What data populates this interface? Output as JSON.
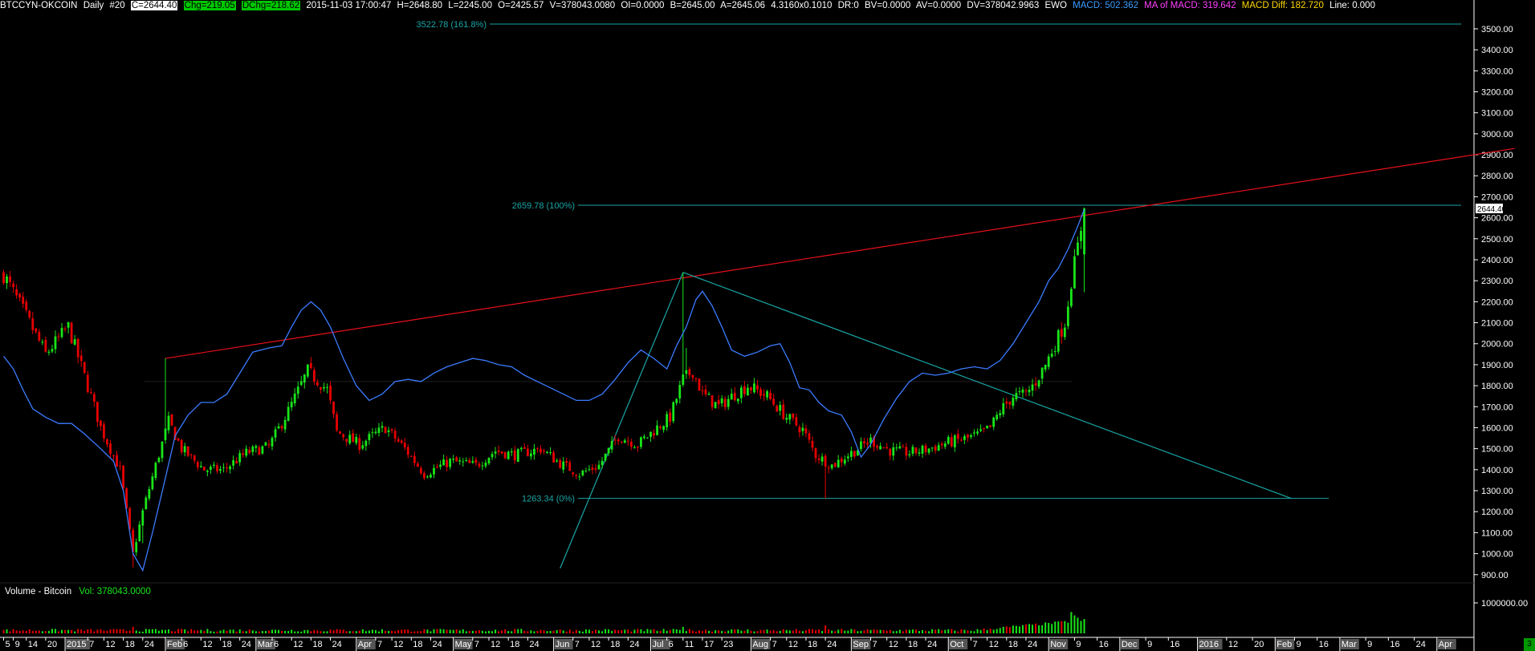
{
  "header": {
    "symbol": "BTCCYN-OKCOIN",
    "period": "Daily",
    "bar_no": "#20",
    "close": "C=2644.40",
    "chg": "Chg=219.05",
    "dchg": "DChg=218.62",
    "datetime": "2015-11-03 17:00:47",
    "high": "H=2648.80",
    "low": "L=2245.00",
    "open": "O=2425.57",
    "volume": "V=378043.0080",
    "oi": "OI=0.0000",
    "bid": "B=2645.00",
    "ask": "A=2645.06",
    "size": "4.3160x0.1010",
    "dr": "DR:0",
    "bv": "BV=0.0000",
    "av": "AV=0.0000",
    "dv": "DV=378042.9963",
    "ewo": "EWO",
    "macd": "MACD: 502.362",
    "ma_macd": "MA of MACD: 319.642",
    "macd_diff": "MACD Diff: 182.720",
    "line": "Line: 0.000"
  },
  "volume_panel": {
    "title": "Volume - Bitcoin",
    "value": "Vol: 378043.0000"
  },
  "corner_badge": "3",
  "colors": {
    "up": "#19e619",
    "down": "#e60000",
    "macd_line": "#3b7bff",
    "trend_line": "#e8101a",
    "fib": "#19a6a6"
  },
  "chart_data": {
    "type": "candlestick",
    "ylim": [
      880,
      3580
    ],
    "y_ticks": [
      "900.00",
      "1000.00",
      "1100.00",
      "1200.00",
      "1300.00",
      "1400.00",
      "1500.00",
      "1600.00",
      "1700.00",
      "1800.00",
      "1900.00",
      "2000.00",
      "2100.00",
      "2200.00",
      "2300.00",
      "2400.00",
      "2500.00",
      "2600.00",
      "2700.00",
      "2800.00",
      "2900.00",
      "3000.00",
      "3100.00",
      "3200.00",
      "3300.00",
      "3400.00",
      "3500.00"
    ],
    "volume_tick": "1000000.00",
    "last_price_label": "2644.40",
    "x_labels": [
      {
        "label": "5",
        "i": 0
      },
      {
        "label": "9",
        "i": 3
      },
      {
        "label": "14",
        "i": 7
      },
      {
        "label": "20",
        "i": 13
      },
      {
        "label": "2015",
        "i": 19,
        "box": true
      },
      {
        "label": "7",
        "i": 26
      },
      {
        "label": "12",
        "i": 31
      },
      {
        "label": "18",
        "i": 37
      },
      {
        "label": "24",
        "i": 43
      },
      {
        "label": "Feb",
        "i": 50,
        "box": true
      },
      {
        "label": "6",
        "i": 55
      },
      {
        "label": "12",
        "i": 61
      },
      {
        "label": "18",
        "i": 67
      },
      {
        "label": "24",
        "i": 73
      },
      {
        "label": "Mar",
        "i": 78,
        "box": true
      },
      {
        "label": "6",
        "i": 83
      },
      {
        "label": "12",
        "i": 89
      },
      {
        "label": "18",
        "i": 95
      },
      {
        "label": "24",
        "i": 101
      },
      {
        "label": "Apr",
        "i": 109,
        "box": true
      },
      {
        "label": "7",
        "i": 115
      },
      {
        "label": "12",
        "i": 120
      },
      {
        "label": "18",
        "i": 126
      },
      {
        "label": "24",
        "i": 132
      },
      {
        "label": "May",
        "i": 139,
        "box": true
      },
      {
        "label": "7",
        "i": 145
      },
      {
        "label": "12",
        "i": 150
      },
      {
        "label": "18",
        "i": 156
      },
      {
        "label": "24",
        "i": 162
      },
      {
        "label": "Jun",
        "i": 170,
        "box": true
      },
      {
        "label": "7",
        "i": 176
      },
      {
        "label": "12",
        "i": 181
      },
      {
        "label": "18",
        "i": 187
      },
      {
        "label": "24",
        "i": 193
      },
      {
        "label": "Jul",
        "i": 200,
        "box": true
      },
      {
        "label": "6",
        "i": 205
      },
      {
        "label": "11",
        "i": 210
      },
      {
        "label": "17",
        "i": 216
      },
      {
        "label": "23",
        "i": 222
      },
      {
        "label": "Aug",
        "i": 231,
        "box": true
      },
      {
        "label": "7",
        "i": 237
      },
      {
        "label": "12",
        "i": 242
      },
      {
        "label": "18",
        "i": 248
      },
      {
        "label": "24",
        "i": 254
      },
      {
        "label": "Sep",
        "i": 262,
        "box": true
      },
      {
        "label": "7",
        "i": 268
      },
      {
        "label": "12",
        "i": 273
      },
      {
        "label": "18",
        "i": 279
      },
      {
        "label": "24",
        "i": 285
      },
      {
        "label": "Oct",
        "i": 292,
        "box": true
      },
      {
        "label": "7",
        "i": 299
      },
      {
        "label": "12",
        "i": 304
      },
      {
        "label": "18",
        "i": 310
      },
      {
        "label": "24",
        "i": 316
      },
      {
        "label": "Nov",
        "i": 323,
        "box": true
      },
      {
        "label": "9",
        "i": 331
      },
      {
        "label": "16",
        "i": 338
      },
      {
        "label": "Dec",
        "i": 345,
        "box": true
      },
      {
        "label": "9",
        "i": 353
      },
      {
        "label": "16",
        "i": 360
      },
      {
        "label": "2016",
        "i": 369,
        "box": true
      },
      {
        "label": "12",
        "i": 378
      },
      {
        "label": "20",
        "i": 386
      },
      {
        "label": "Feb",
        "i": 393,
        "box": true
      },
      {
        "label": "9",
        "i": 399
      },
      {
        "label": "16",
        "i": 406
      },
      {
        "label": "Mar",
        "i": 413,
        "box": true
      },
      {
        "label": "9",
        "i": 421
      },
      {
        "label": "16",
        "i": 428
      },
      {
        "label": "24",
        "i": 436
      },
      {
        "label": "Apr",
        "i": 443,
        "box": true
      },
      {
        "label": "12",
        "i": 454
      },
      {
        "label": "20",
        "i": 462
      }
    ],
    "fib_levels": [
      {
        "price": 3522.78,
        "label": "3522.78  (161.8%)"
      },
      {
        "price": 2659.78,
        "label": "2659.78  (100%)"
      },
      {
        "price": 1263.34,
        "label": "1263.34  (0%)"
      }
    ],
    "trendlines": [
      {
        "from": [
          50,
          1930
        ],
        "to": [
          467,
          2930
        ],
        "color": "trend_line"
      },
      {
        "from": [
          210,
          2340
        ],
        "to": [
          398,
          1263
        ],
        "color": "fib"
      },
      {
        "from": [
          172,
          930
        ],
        "to": [
          210,
          2340
        ],
        "color": "fib"
      }
    ],
    "anchors": [
      {
        "i": 0,
        "v": 2330
      },
      {
        "i": 8,
        "v": 2100
      },
      {
        "i": 13,
        "v": 1950
      },
      {
        "i": 20,
        "v": 2080
      },
      {
        "i": 27,
        "v": 1750
      },
      {
        "i": 30,
        "v": 1600
      },
      {
        "i": 36,
        "v": 1400
      },
      {
        "i": 40,
        "v": 1000
      },
      {
        "i": 43,
        "v": 1200
      },
      {
        "i": 47,
        "v": 1420
      },
      {
        "i": 51,
        "v": 1630
      },
      {
        "i": 55,
        "v": 1500
      },
      {
        "i": 62,
        "v": 1400
      },
      {
        "i": 68,
        "v": 1400
      },
      {
        "i": 75,
        "v": 1480
      },
      {
        "i": 82,
        "v": 1510
      },
      {
        "i": 88,
        "v": 1680
      },
      {
        "i": 94,
        "v": 1870
      },
      {
        "i": 100,
        "v": 1780
      },
      {
        "i": 103,
        "v": 1580
      },
      {
        "i": 110,
        "v": 1520
      },
      {
        "i": 118,
        "v": 1600
      },
      {
        "i": 124,
        "v": 1500
      },
      {
        "i": 130,
        "v": 1380
      },
      {
        "i": 138,
        "v": 1440
      },
      {
        "i": 146,
        "v": 1420
      },
      {
        "i": 152,
        "v": 1490
      },
      {
        "i": 158,
        "v": 1470
      },
      {
        "i": 166,
        "v": 1500
      },
      {
        "i": 172,
        "v": 1430
      },
      {
        "i": 178,
        "v": 1380
      },
      {
        "i": 184,
        "v": 1420
      },
      {
        "i": 190,
        "v": 1560
      },
      {
        "i": 196,
        "v": 1520
      },
      {
        "i": 202,
        "v": 1600
      },
      {
        "i": 206,
        "v": 1650
      },
      {
        "i": 210,
        "v": 1830
      },
      {
        "i": 213,
        "v": 1870
      },
      {
        "i": 216,
        "v": 1760
      },
      {
        "i": 221,
        "v": 1700
      },
      {
        "i": 226,
        "v": 1760
      },
      {
        "i": 230,
        "v": 1800
      },
      {
        "i": 236,
        "v": 1750
      },
      {
        "i": 242,
        "v": 1650
      },
      {
        "i": 247,
        "v": 1590
      },
      {
        "i": 251,
        "v": 1470
      },
      {
        "i": 256,
        "v": 1420
      },
      {
        "i": 262,
        "v": 1480
      },
      {
        "i": 268,
        "v": 1540
      },
      {
        "i": 274,
        "v": 1490
      },
      {
        "i": 280,
        "v": 1480
      },
      {
        "i": 286,
        "v": 1500
      },
      {
        "i": 292,
        "v": 1530
      },
      {
        "i": 298,
        "v": 1550
      },
      {
        "i": 302,
        "v": 1570
      },
      {
        "i": 305,
        "v": 1600
      },
      {
        "i": 308,
        "v": 1680
      },
      {
        "i": 312,
        "v": 1750
      },
      {
        "i": 316,
        "v": 1760
      },
      {
        "i": 319,
        "v": 1820
      },
      {
        "i": 322,
        "v": 1900
      },
      {
        "i": 325,
        "v": 2000
      },
      {
        "i": 328,
        "v": 2100
      },
      {
        "i": 330,
        "v": 2300
      },
      {
        "i": 332,
        "v": 2460
      },
      {
        "i": 334,
        "v": 2644
      }
    ],
    "macd_points": [
      [
        0,
        1940
      ],
      [
        3,
        1880
      ],
      [
        6,
        1780
      ],
      [
        9,
        1690
      ],
      [
        13,
        1650
      ],
      [
        17,
        1620
      ],
      [
        21,
        1620
      ],
      [
        25,
        1570
      ],
      [
        30,
        1500
      ],
      [
        34,
        1440
      ],
      [
        37,
        1300
      ],
      [
        40,
        1000
      ],
      [
        43,
        920
      ],
      [
        46,
        1100
      ],
      [
        50,
        1360
      ],
      [
        53,
        1560
      ],
      [
        57,
        1660
      ],
      [
        61,
        1720
      ],
      [
        65,
        1720
      ],
      [
        69,
        1760
      ],
      [
        73,
        1860
      ],
      [
        77,
        1960
      ],
      [
        82,
        1980
      ],
      [
        86,
        1990
      ],
      [
        89,
        2080
      ],
      [
        92,
        2160
      ],
      [
        95,
        2200
      ],
      [
        98,
        2160
      ],
      [
        101,
        2080
      ],
      [
        105,
        1930
      ],
      [
        109,
        1800
      ],
      [
        113,
        1730
      ],
      [
        117,
        1760
      ],
      [
        121,
        1820
      ],
      [
        125,
        1830
      ],
      [
        129,
        1820
      ],
      [
        133,
        1860
      ],
      [
        137,
        1890
      ],
      [
        141,
        1910
      ],
      [
        145,
        1930
      ],
      [
        149,
        1920
      ],
      [
        153,
        1900
      ],
      [
        157,
        1890
      ],
      [
        161,
        1850
      ],
      [
        165,
        1820
      ],
      [
        169,
        1790
      ],
      [
        173,
        1760
      ],
      [
        177,
        1730
      ],
      [
        181,
        1730
      ],
      [
        185,
        1760
      ],
      [
        189,
        1830
      ],
      [
        193,
        1910
      ],
      [
        197,
        1970
      ],
      [
        201,
        1930
      ],
      [
        205,
        1880
      ],
      [
        208,
        1990
      ],
      [
        211,
        2080
      ],
      [
        214,
        2210
      ],
      [
        216,
        2250
      ],
      [
        219,
        2180
      ],
      [
        222,
        2080
      ],
      [
        225,
        1970
      ],
      [
        229,
        1940
      ],
      [
        233,
        1960
      ],
      [
        237,
        1990
      ],
      [
        240,
        2000
      ],
      [
        243,
        1910
      ],
      [
        246,
        1790
      ],
      [
        249,
        1780
      ],
      [
        252,
        1720
      ],
      [
        255,
        1680
      ],
      [
        259,
        1660
      ],
      [
        262,
        1580
      ],
      [
        265,
        1460
      ],
      [
        268,
        1520
      ],
      [
        272,
        1640
      ],
      [
        276,
        1740
      ],
      [
        280,
        1820
      ],
      [
        284,
        1860
      ],
      [
        288,
        1850
      ],
      [
        292,
        1860
      ],
      [
        296,
        1880
      ],
      [
        300,
        1890
      ],
      [
        304,
        1880
      ],
      [
        308,
        1920
      ],
      [
        312,
        2000
      ],
      [
        316,
        2100
      ],
      [
        320,
        2200
      ],
      [
        323,
        2300
      ],
      [
        326,
        2360
      ],
      [
        329,
        2450
      ],
      [
        332,
        2560
      ],
      [
        334,
        2640
      ]
    ]
  }
}
